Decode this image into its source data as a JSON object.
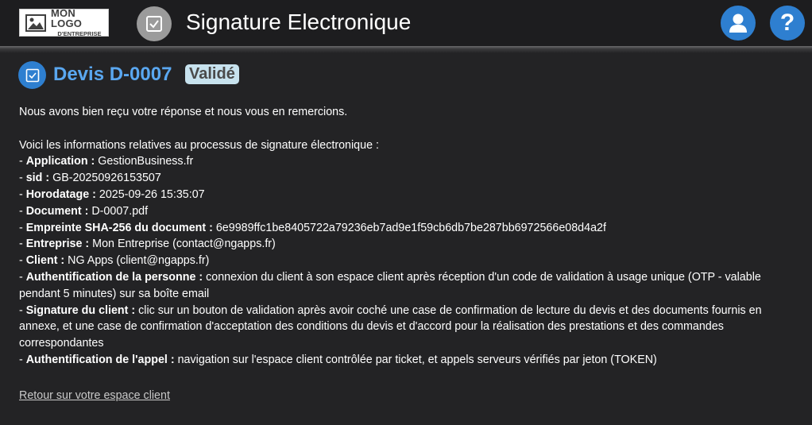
{
  "header": {
    "logo_line1": "MON LOGO",
    "logo_line2": "D'ENTREPRISE",
    "app_icon": "checkbox-icon",
    "title": "Signature Electronique",
    "user_icon": "user-icon",
    "help_icon": "help-icon",
    "help_glyph": "?"
  },
  "document": {
    "icon": "checkbox-icon",
    "title": "Devis D-0007",
    "status": "Validé"
  },
  "content": {
    "thanks": "Nous avons bien reçu votre réponse et nous vous en remercions.",
    "intro": "Voici les informations relatives au processus de signature électronique :",
    "items": [
      {
        "prefix": "- ",
        "label": "Application :",
        "value": " GestionBusiness.fr"
      },
      {
        "prefix": "- ",
        "label": "sid :",
        "value": " GB-20250926153507"
      },
      {
        "prefix": "- ",
        "label": "Horodatage :",
        "value": " 2025-09-26 15:35:07"
      },
      {
        "prefix": "- ",
        "label": "Document :",
        "value": " D-0007.pdf"
      },
      {
        "prefix": "- ",
        "label": "Empreinte SHA-256 du document :",
        "value": " 6e9989ffc1be8405722a79236eb7ad9e1f59cb6db7be287bb6972566e08d4a2f"
      },
      {
        "prefix": "- ",
        "label": "Entreprise :",
        "value": " Mon Entreprise (contact@ngapps.fr)"
      },
      {
        "prefix": "- ",
        "label": "Client :",
        "value": " NG Apps (client@ngapps.fr)"
      },
      {
        "prefix": "- ",
        "label": "Authentification de la personne :",
        "value": " connexion du client à son espace client après réception d'un code de validation à usage unique (OTP - valable pendant 5 minutes) sur sa boîte email"
      },
      {
        "prefix": "- ",
        "label": "Signature du client :",
        "value": " clic sur un bouton de validation après avoir coché une case de confirmation de lecture du devis et des documents fournis en annexe, et une case de confirmation d'acceptation des conditions du devis et d'accord pour la réalisation des prestations et des commandes correspondantes"
      },
      {
        "prefix": "- ",
        "label": "Authentification de l'appel :",
        "value": " navigation sur l'espace client contrôlée par ticket, et appels serveurs vérifiés par jeton (TOKEN)"
      }
    ],
    "back_link": "Retour sur votre espace client"
  },
  "colors": {
    "accent": "#2e7fd0",
    "title_blue": "#5aa7f0",
    "badge_bg": "#c7e2ee",
    "background": "#232325"
  }
}
